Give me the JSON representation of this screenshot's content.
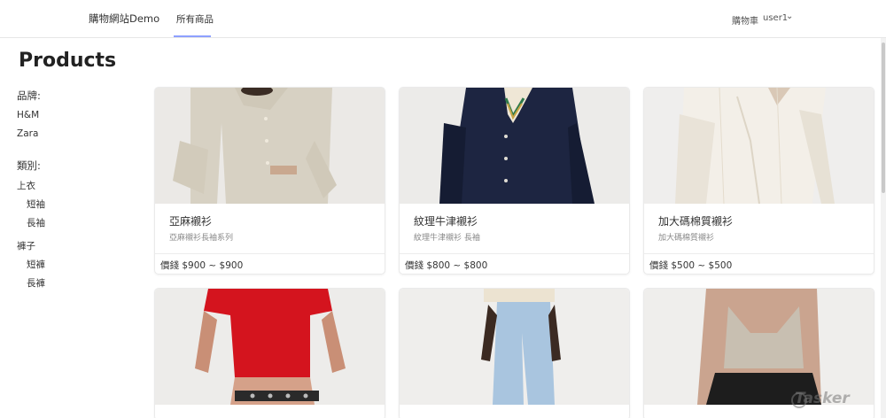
{
  "nav": {
    "brand": "購物網站Demo",
    "all_products": "所有商品",
    "cart": "購物車",
    "user": "user1",
    "caret": "⌄"
  },
  "page": {
    "title": "Products"
  },
  "sidebar": {
    "brand_heading": "品牌:",
    "brands": [
      "H&M",
      "Zara"
    ],
    "category_heading": "類別:",
    "tops": "上衣",
    "tops_children": [
      "短袖",
      "長袖"
    ],
    "bottoms": "褲子",
    "bottoms_children": [
      "短褲",
      "長褲"
    ]
  },
  "products": [
    {
      "title": "亞麻襯衫",
      "subtitle": "亞麻襯衫長袖系列",
      "price": "價錢 $900 ~ $900"
    },
    {
      "title": "紋理牛津襯衫",
      "subtitle": "紋理牛津襯衫 長袖",
      "price": "價錢 $800 ~ $800"
    },
    {
      "title": "加大碼棉質襯衫",
      "subtitle": "加大碼棉質襯衫",
      "price": "價錢 $500 ~ $500"
    }
  ],
  "watermark": "Tasker"
}
